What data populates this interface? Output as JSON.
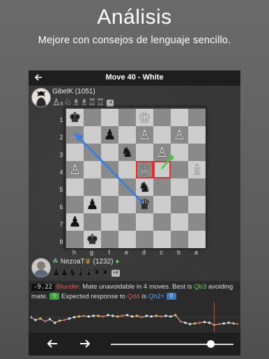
{
  "promo": {
    "title": "Análisis",
    "subtitle": "Mejore con consejos de lenguaje sencillo."
  },
  "header": {
    "back_icon": "arrow-left-icon",
    "title": "Move 40 - White"
  },
  "top_player": {
    "name": "GibelK (1051)",
    "captured_count": "6",
    "material_diff": "-4"
  },
  "bottom_player": {
    "name_prefix": "NezoaT",
    "rating": "(1232)",
    "material_diff": "+4"
  },
  "board": {
    "ranks": [
      "1",
      "2",
      "3",
      "4",
      "5",
      "6",
      "7",
      "8"
    ],
    "files": [
      "h",
      "g",
      "f",
      "e",
      "d",
      "c",
      "b",
      "a"
    ]
  },
  "analysis": {
    "score": "-9.22",
    "label": "Blunder.",
    "text1": "Mate unavoidable in 4 moves. Best is",
    "best_move": "Qb3",
    "text2": "avoiding mate.",
    "text3": "Expected response to",
    "played_move": "Qd4",
    "text4": "is",
    "response_move": "Qh2+"
  },
  "colors": {
    "blunder": "#e05a4a",
    "best": "#5fd35a",
    "response": "#5a9cf0"
  },
  "footer": {
    "prev_icon": "arrow-left-icon",
    "next_icon": "arrow-right-icon",
    "progress": 0.9
  }
}
